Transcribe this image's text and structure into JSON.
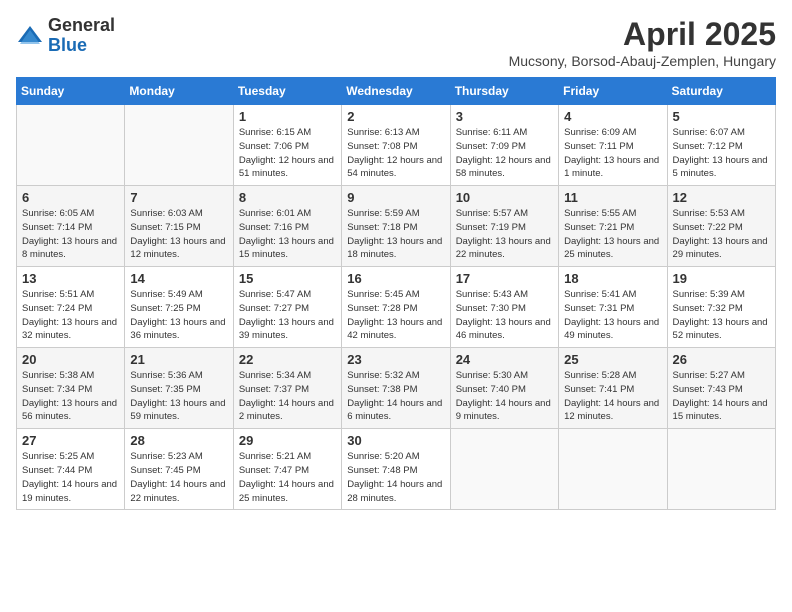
{
  "logo": {
    "general": "General",
    "blue": "Blue"
  },
  "calendar": {
    "title": "April 2025",
    "subtitle": "Mucsony, Borsod-Abauj-Zemplen, Hungary"
  },
  "headers": [
    "Sunday",
    "Monday",
    "Tuesday",
    "Wednesday",
    "Thursday",
    "Friday",
    "Saturday"
  ],
  "weeks": [
    [
      {
        "day": "",
        "info": ""
      },
      {
        "day": "",
        "info": ""
      },
      {
        "day": "1",
        "info": "Sunrise: 6:15 AM\nSunset: 7:06 PM\nDaylight: 12 hours and 51 minutes."
      },
      {
        "day": "2",
        "info": "Sunrise: 6:13 AM\nSunset: 7:08 PM\nDaylight: 12 hours and 54 minutes."
      },
      {
        "day": "3",
        "info": "Sunrise: 6:11 AM\nSunset: 7:09 PM\nDaylight: 12 hours and 58 minutes."
      },
      {
        "day": "4",
        "info": "Sunrise: 6:09 AM\nSunset: 7:11 PM\nDaylight: 13 hours and 1 minute."
      },
      {
        "day": "5",
        "info": "Sunrise: 6:07 AM\nSunset: 7:12 PM\nDaylight: 13 hours and 5 minutes."
      }
    ],
    [
      {
        "day": "6",
        "info": "Sunrise: 6:05 AM\nSunset: 7:14 PM\nDaylight: 13 hours and 8 minutes."
      },
      {
        "day": "7",
        "info": "Sunrise: 6:03 AM\nSunset: 7:15 PM\nDaylight: 13 hours and 12 minutes."
      },
      {
        "day": "8",
        "info": "Sunrise: 6:01 AM\nSunset: 7:16 PM\nDaylight: 13 hours and 15 minutes."
      },
      {
        "day": "9",
        "info": "Sunrise: 5:59 AM\nSunset: 7:18 PM\nDaylight: 13 hours and 18 minutes."
      },
      {
        "day": "10",
        "info": "Sunrise: 5:57 AM\nSunset: 7:19 PM\nDaylight: 13 hours and 22 minutes."
      },
      {
        "day": "11",
        "info": "Sunrise: 5:55 AM\nSunset: 7:21 PM\nDaylight: 13 hours and 25 minutes."
      },
      {
        "day": "12",
        "info": "Sunrise: 5:53 AM\nSunset: 7:22 PM\nDaylight: 13 hours and 29 minutes."
      }
    ],
    [
      {
        "day": "13",
        "info": "Sunrise: 5:51 AM\nSunset: 7:24 PM\nDaylight: 13 hours and 32 minutes."
      },
      {
        "day": "14",
        "info": "Sunrise: 5:49 AM\nSunset: 7:25 PM\nDaylight: 13 hours and 36 minutes."
      },
      {
        "day": "15",
        "info": "Sunrise: 5:47 AM\nSunset: 7:27 PM\nDaylight: 13 hours and 39 minutes."
      },
      {
        "day": "16",
        "info": "Sunrise: 5:45 AM\nSunset: 7:28 PM\nDaylight: 13 hours and 42 minutes."
      },
      {
        "day": "17",
        "info": "Sunrise: 5:43 AM\nSunset: 7:30 PM\nDaylight: 13 hours and 46 minutes."
      },
      {
        "day": "18",
        "info": "Sunrise: 5:41 AM\nSunset: 7:31 PM\nDaylight: 13 hours and 49 minutes."
      },
      {
        "day": "19",
        "info": "Sunrise: 5:39 AM\nSunset: 7:32 PM\nDaylight: 13 hours and 52 minutes."
      }
    ],
    [
      {
        "day": "20",
        "info": "Sunrise: 5:38 AM\nSunset: 7:34 PM\nDaylight: 13 hours and 56 minutes."
      },
      {
        "day": "21",
        "info": "Sunrise: 5:36 AM\nSunset: 7:35 PM\nDaylight: 13 hours and 59 minutes."
      },
      {
        "day": "22",
        "info": "Sunrise: 5:34 AM\nSunset: 7:37 PM\nDaylight: 14 hours and 2 minutes."
      },
      {
        "day": "23",
        "info": "Sunrise: 5:32 AM\nSunset: 7:38 PM\nDaylight: 14 hours and 6 minutes."
      },
      {
        "day": "24",
        "info": "Sunrise: 5:30 AM\nSunset: 7:40 PM\nDaylight: 14 hours and 9 minutes."
      },
      {
        "day": "25",
        "info": "Sunrise: 5:28 AM\nSunset: 7:41 PM\nDaylight: 14 hours and 12 minutes."
      },
      {
        "day": "26",
        "info": "Sunrise: 5:27 AM\nSunset: 7:43 PM\nDaylight: 14 hours and 15 minutes."
      }
    ],
    [
      {
        "day": "27",
        "info": "Sunrise: 5:25 AM\nSunset: 7:44 PM\nDaylight: 14 hours and 19 minutes."
      },
      {
        "day": "28",
        "info": "Sunrise: 5:23 AM\nSunset: 7:45 PM\nDaylight: 14 hours and 22 minutes."
      },
      {
        "day": "29",
        "info": "Sunrise: 5:21 AM\nSunset: 7:47 PM\nDaylight: 14 hours and 25 minutes."
      },
      {
        "day": "30",
        "info": "Sunrise: 5:20 AM\nSunset: 7:48 PM\nDaylight: 14 hours and 28 minutes."
      },
      {
        "day": "",
        "info": ""
      },
      {
        "day": "",
        "info": ""
      },
      {
        "day": "",
        "info": ""
      }
    ]
  ]
}
